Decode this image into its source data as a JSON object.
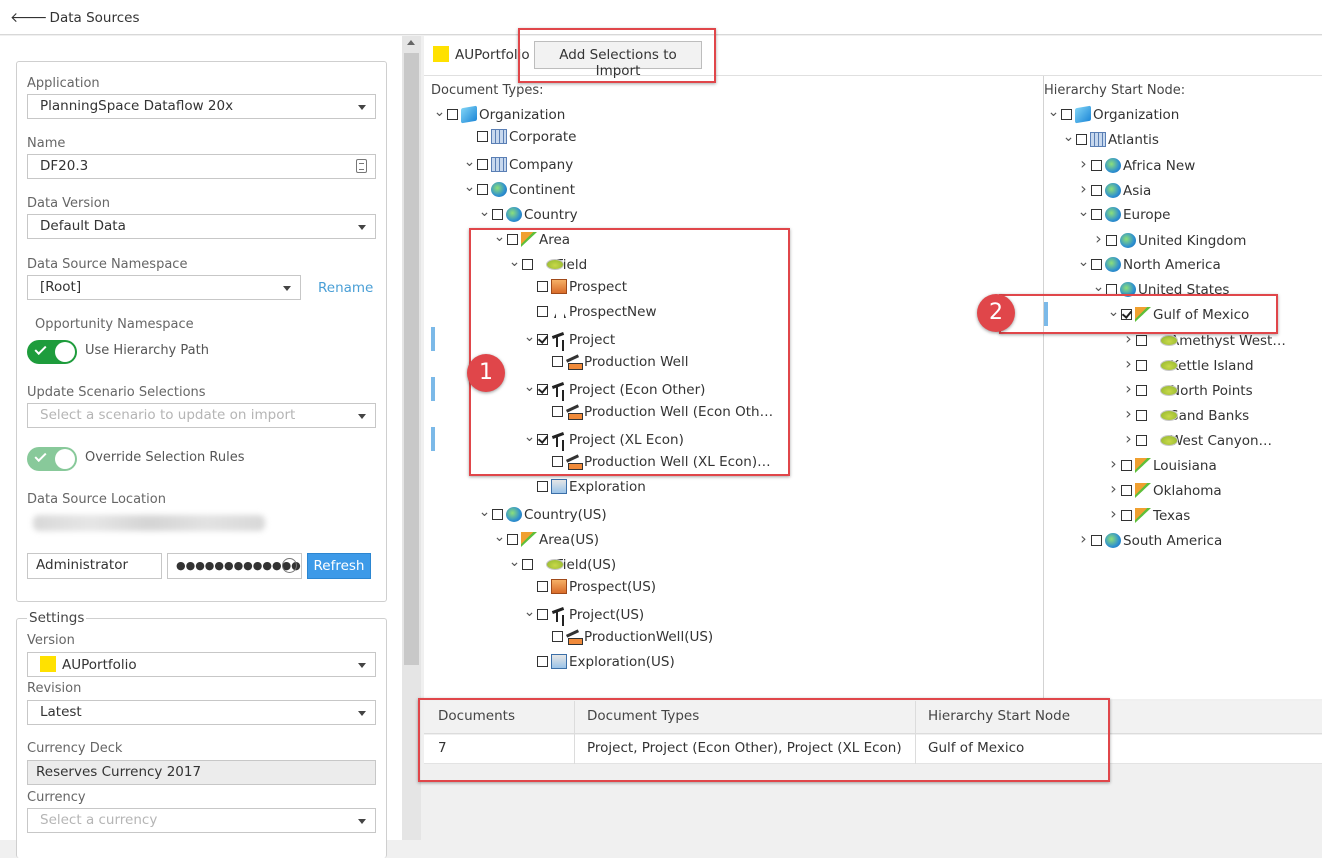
{
  "topbar": {
    "back_label": "Data Sources"
  },
  "left": {
    "application_label": "Application",
    "application_value": "PlanningSpace Dataflow 20x",
    "name_label": "Name",
    "name_value": "DF20.3",
    "data_version_label": "Data Version",
    "data_version_value": "Default Data",
    "namespace_label": "Data Source Namespace",
    "namespace_value": "[Root]",
    "rename_label": "Rename",
    "opp_namespace_label": "Opportunity Namespace",
    "use_hierarchy_label": "Use Hierarchy Path",
    "update_scenario_label": "Update Scenario Selections",
    "update_scenario_placeholder": "Select a scenario to update on import",
    "override_label": "Override Selection Rules",
    "location_label": "Data Source Location",
    "username": "Administrator",
    "password_mask": "●●●●●●●●●●●●●",
    "refresh_label": "Refresh"
  },
  "settings": {
    "title": "Settings",
    "version_label": "Version",
    "version_value": "AUPortfolio",
    "version_color": "#ffe100",
    "revision_label": "Revision",
    "revision_value": "Latest",
    "currency_deck_label": "Currency Deck",
    "currency_deck_value": "Reserves Currency 2017",
    "currency_label": "Currency",
    "currency_placeholder": "Select a currency"
  },
  "toolbar": {
    "portfolio_name": "AUPortfolio",
    "add_button": "Add Selections to Import"
  },
  "doc_tree": {
    "title": "Document Types:",
    "items": [
      {
        "label": "Organization",
        "icon": "org-icon",
        "exp": "v",
        "checked": false
      },
      {
        "label": "Corporate",
        "icon": "building-icon",
        "exp": "",
        "checked": false
      },
      {
        "label": "Company",
        "icon": "building-icon",
        "exp": "v",
        "checked": false
      },
      {
        "label": "Continent",
        "icon": "globe-icon",
        "exp": "v",
        "checked": false
      },
      {
        "label": "Country",
        "icon": "globe-icon",
        "exp": "v",
        "checked": false
      },
      {
        "label": "Area",
        "icon": "area-icon",
        "exp": "v",
        "checked": false
      },
      {
        "label": "Field",
        "icon": "field-icon",
        "exp": "v",
        "checked": false
      },
      {
        "label": "Prospect",
        "icon": "prospect-icon",
        "exp": "",
        "checked": false
      },
      {
        "label": "ProspectNew",
        "icon": "rig-icon",
        "exp": "",
        "checked": false
      },
      {
        "label": "Project",
        "icon": "pumpjack-icon",
        "exp": "v",
        "checked": true
      },
      {
        "label": "Production Well",
        "icon": "well-icon",
        "exp": "",
        "checked": false
      },
      {
        "label": "Project (Econ Other)",
        "icon": "pumpjack-icon",
        "exp": "v",
        "checked": true
      },
      {
        "label": "Production Well (Econ Oth…",
        "icon": "well-icon",
        "exp": "",
        "checked": false
      },
      {
        "label": "Project (XL Econ)",
        "icon": "pumpjack-icon",
        "exp": "v",
        "checked": true
      },
      {
        "label": "Production Well (XL Econ)…",
        "icon": "well-icon",
        "exp": "",
        "checked": false
      },
      {
        "label": "Exploration",
        "icon": "exploration-icon",
        "exp": "",
        "checked": false
      },
      {
        "label": "Country(US)",
        "icon": "globe-icon",
        "exp": "v",
        "checked": false
      },
      {
        "label": "Area(US)",
        "icon": "area-icon",
        "exp": "v",
        "checked": false
      },
      {
        "label": "Field(US)",
        "icon": "field-icon",
        "exp": "v",
        "checked": false
      },
      {
        "label": "Prospect(US)",
        "icon": "prospect-icon",
        "exp": "",
        "checked": false
      },
      {
        "label": "Project(US)",
        "icon": "pumpjack-icon",
        "exp": "v",
        "checked": false
      },
      {
        "label": "ProductionWell(US)",
        "icon": "well-icon",
        "exp": "",
        "checked": false
      },
      {
        "label": "Exploration(US)",
        "icon": "exploration-icon",
        "exp": "",
        "checked": false
      }
    ]
  },
  "hier_tree": {
    "title": "Hierarchy Start Node:",
    "items": [
      {
        "label": "Organization",
        "icon": "org-icon",
        "exp": "v",
        "checked": false
      },
      {
        "label": "Atlantis",
        "icon": "building-icon",
        "exp": "v",
        "checked": false
      },
      {
        "label": "Africa New",
        "icon": "globe-icon",
        "exp": ">",
        "checked": false
      },
      {
        "label": "Asia",
        "icon": "globe-icon",
        "exp": ">",
        "checked": false
      },
      {
        "label": "Europe",
        "icon": "globe-icon",
        "exp": "v",
        "checked": false
      },
      {
        "label": "United Kingdom",
        "icon": "globe-icon",
        "exp": ">",
        "checked": false
      },
      {
        "label": "North America",
        "icon": "globe-icon",
        "exp": "v",
        "checked": false
      },
      {
        "label": "United States",
        "icon": "globe-icon",
        "exp": "v",
        "checked": false
      },
      {
        "label": "Gulf of Mexico",
        "icon": "area-icon",
        "exp": "v",
        "checked": true
      },
      {
        "label": "Amethyst West…",
        "icon": "field-icon",
        "exp": ">",
        "checked": false
      },
      {
        "label": "Kettle Island",
        "icon": "field-icon",
        "exp": ">",
        "checked": false
      },
      {
        "label": "North Points",
        "icon": "field-icon",
        "exp": ">",
        "checked": false
      },
      {
        "label": "Sand Banks",
        "icon": "field-icon",
        "exp": ">",
        "checked": false
      },
      {
        "label": "West Canyon…",
        "icon": "field-icon",
        "exp": ">",
        "checked": false
      },
      {
        "label": "Louisiana",
        "icon": "area-icon",
        "exp": ">",
        "checked": false
      },
      {
        "label": "Oklahoma",
        "icon": "area-icon",
        "exp": ">",
        "checked": false
      },
      {
        "label": "Texas",
        "icon": "area-icon",
        "exp": ">",
        "checked": false
      },
      {
        "label": "South America",
        "icon": "globe-icon",
        "exp": ">",
        "checked": false
      }
    ]
  },
  "summary": {
    "headers": [
      "Documents",
      "Document Types",
      "Hierarchy Start Node"
    ],
    "row": [
      "7",
      "Project, Project (Econ Other), Project (XL Econ)",
      "Gulf of Mexico"
    ]
  },
  "callouts": [
    "1",
    "2"
  ],
  "accent_red": "#e0464a"
}
